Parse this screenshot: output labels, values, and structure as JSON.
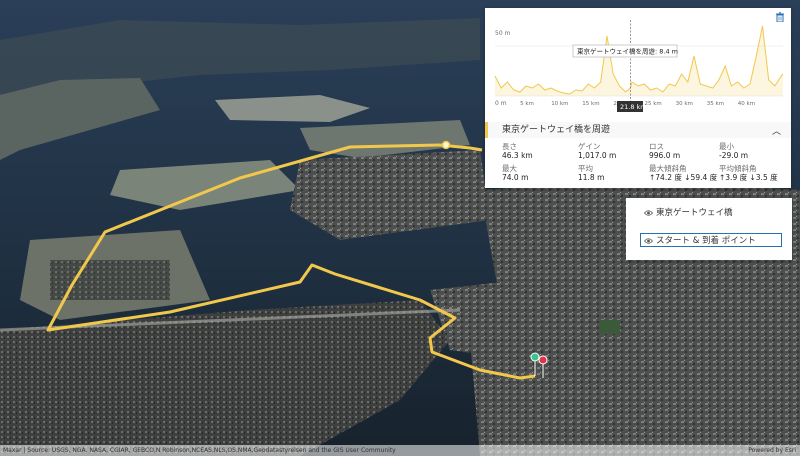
{
  "profile": {
    "ylabel_top": "50 m",
    "ylabel_bottom": "0 m",
    "x_ticks": [
      "5 km",
      "10 km",
      "15 km",
      "20 km",
      "25 km",
      "30 km",
      "35 km",
      "40 km"
    ],
    "tooltip": "東京ゲートウェイ橋を周遊: 8.4 m",
    "cursor_label": "21.8 km",
    "stats_title": "東京ゲートウェイ橋を周遊",
    "stats": {
      "length_label": "長さ",
      "length_value": "46.3 km",
      "gain_label": "ゲイン",
      "gain_value": "1,017.0 m",
      "loss_label": "ロス",
      "loss_value": "996.0 m",
      "min_label": "最小",
      "min_value": "-29.0 m",
      "max_label": "最大",
      "max_value": "74.0 m",
      "avg_label": "平均",
      "avg_value": "11.8 m",
      "max_slope_label": "最大傾斜角",
      "max_slope_up": "↑74.2 度",
      "max_slope_down": "↓59.4 度",
      "avg_slope_label": "平均傾斜角",
      "avg_slope_up": "↑3.9 度",
      "avg_slope_down": "↓3.5 度"
    },
    "line_color": "#f1c84b"
  },
  "layers": {
    "items": [
      {
        "label": "東京ゲートウェイ橋"
      },
      {
        "label": "スタート & 到着 ポイント"
      }
    ]
  },
  "attribution": {
    "text": "Maxar | Source: USGS, NGA, NASA, CGIAR, GEBCO,N Robinson,NCEAS,NLS,OS,NMA,Geodatastyrelsen and the GIS User Community",
    "powered": "Powered by Esri"
  },
  "chart_data": {
    "type": "area",
    "x": [
      0,
      1,
      2,
      3,
      4,
      5,
      6,
      7,
      8,
      9,
      10,
      11,
      12,
      13,
      14,
      15,
      16,
      17,
      18,
      19,
      20,
      21,
      21.8,
      22,
      23,
      24,
      25,
      26,
      27,
      28,
      29,
      30,
      31,
      32,
      33,
      34,
      35,
      36,
      37,
      38,
      39,
      40,
      41,
      42,
      43,
      44,
      45,
      46,
      46.3
    ],
    "y": [
      20,
      8,
      14,
      6,
      4,
      10,
      8,
      12,
      6,
      8,
      5,
      3,
      2,
      6,
      5,
      12,
      8,
      14,
      60,
      22,
      10,
      4,
      8.4,
      14,
      10,
      12,
      6,
      8,
      4,
      12,
      10,
      22,
      14,
      40,
      12,
      10,
      8,
      16,
      30,
      10,
      14,
      8,
      12,
      40,
      70,
      16,
      10,
      20,
      22
    ],
    "xlabel": "",
    "ylabel": "",
    "ylim": [
      0,
      74
    ],
    "xlim": [
      0,
      46.3
    ]
  }
}
